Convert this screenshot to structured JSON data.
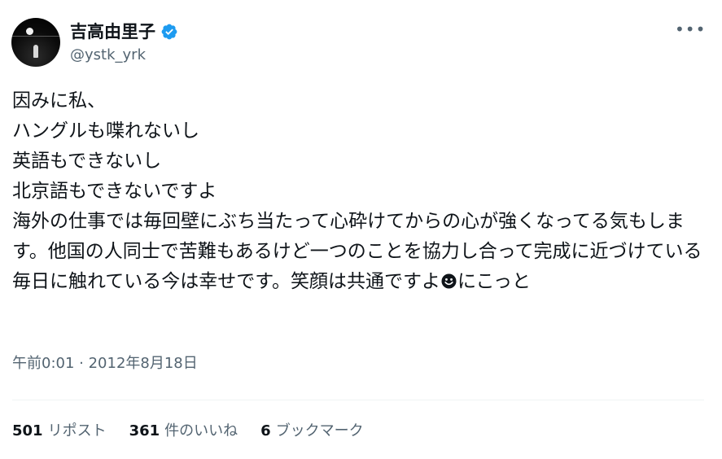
{
  "author": {
    "display_name": "吉高由里子",
    "handle": "@ystk_yrk"
  },
  "icons": {
    "verified": "verified-badge-icon",
    "more": "more-horizontal-icon",
    "emoji": "smiling-face-emoji",
    "verified_color": "#1d9bf0"
  },
  "tweet": {
    "text_before_emoji": "因みに私、\nハングルも喋れないし\n英語もできないし\n北京語もできないですよ\n海外の仕事では毎回壁にぶち当たって心砕けてからの心が強くなってる気もします。他国の人同士で苦難もあるけど一つのことを協力し合って完成に近づけている毎日に触れている今は幸せです。笑顔は共通ですよ",
    "text_after_emoji": "にこっと",
    "timestamp": "午前0:01 · 2012年8月18日"
  },
  "stats": {
    "retweets": {
      "count": "501",
      "label": "リポスト"
    },
    "likes": {
      "count": "361",
      "label": "件のいいね"
    },
    "bookmarks": {
      "count": "6",
      "label": "ブックマーク"
    }
  }
}
